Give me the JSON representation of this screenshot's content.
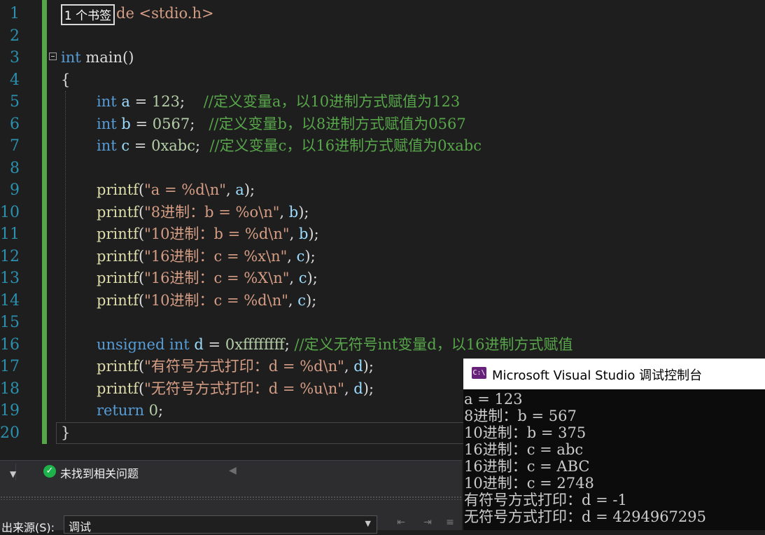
{
  "editor": {
    "bookmark_label": "1 个书签",
    "line_numbers": [
      "1",
      "2",
      "3",
      "4",
      "5",
      "6",
      "7",
      "8",
      "9",
      "10",
      "11",
      "12",
      "13",
      "14",
      "15",
      "16",
      "17",
      "18",
      "19",
      "20"
    ],
    "code": {
      "l1_rest": "de <stdio.h>",
      "l3_kw": "int",
      "l3_fn": " main",
      "l3_rest": "()",
      "l4": "{",
      "l5_kw": "int",
      "l5_var": " a",
      "l5_op": " = ",
      "l5_num": "123",
      "l5_semi": ";",
      "l5_cm": "    //定义变量a，以10进制方式赋值为123",
      "l6_kw": "int",
      "l6_var": " b",
      "l6_op": " = ",
      "l6_num": "0567",
      "l6_semi": ";",
      "l6_cm": "   //定义变量b，以8进制方式赋值为0567",
      "l7_kw": "int",
      "l7_var": " c",
      "l7_op": " = ",
      "l7_num": "0xabc",
      "l7_semi": ";",
      "l7_cm": "  //定义变量c，以16进制方式赋值为0xabc",
      "l9_fn": "printf",
      "l9_p": "(",
      "l9_str": "\"a = %d\\n\"",
      "l9_c": ", ",
      "l9_var": "a",
      "l9_end": ");",
      "l10_fn": "printf",
      "l10_p": "(",
      "l10_str": "\"8进制：b = %o\\n\"",
      "l10_c": ", ",
      "l10_var": "b",
      "l10_end": ");",
      "l11_fn": "printf",
      "l11_p": "(",
      "l11_str": "\"10进制：b = %d\\n\"",
      "l11_c": ", ",
      "l11_var": "b",
      "l11_end": ");",
      "l12_fn": "printf",
      "l12_p": "(",
      "l12_str": "\"16进制：c = %x\\n\"",
      "l12_c": ", ",
      "l12_var": "c",
      "l12_end": ");",
      "l13_fn": "printf",
      "l13_p": "(",
      "l13_str": "\"16进制：c = %X\\n\"",
      "l13_c": ", ",
      "l13_var": "c",
      "l13_end": ");",
      "l14_fn": "printf",
      "l14_p": "(",
      "l14_str": "\"10进制：c = %d\\n\"",
      "l14_c": ", ",
      "l14_var": "c",
      "l14_end": ");",
      "l16_kw": "unsigned int",
      "l16_var": " d",
      "l16_op": " = ",
      "l16_num": "0xffffffff",
      "l16_semi": ";",
      "l16_cm": " //定义无符号int变量d，以16进制方式赋值",
      "l17_fn": "printf",
      "l17_p": "(",
      "l17_str": "\"有符号方式打印：d = %d\\n\"",
      "l17_c": ", ",
      "l17_var": "d",
      "l17_end": ");",
      "l18_fn": "printf",
      "l18_p": "(",
      "l18_str": "\"无符号方式打印：d = %u\\n\"",
      "l18_c": ", ",
      "l18_var": "d",
      "l18_end": ");",
      "l19_kw": "return",
      "l19_num": " 0",
      "l19_semi": ";",
      "l20": "}"
    }
  },
  "status": {
    "issues_text": "未找到相关问题"
  },
  "output": {
    "source_label": "出来源(S):",
    "source_value": "调试"
  },
  "console": {
    "title": "Microsoft Visual Studio 调试控制台",
    "icon_text": "C:\\",
    "lines": [
      "a = 123",
      "8进制：b = 567",
      "10进制：b = 375",
      "16进制：c = abc",
      "16进制：c = ABC",
      "10进制：c = 2748",
      "有符号方式打印：d = -1",
      "无符号方式打印：d = 4294967295"
    ]
  },
  "colors": {
    "keyword": "#569cd6",
    "function": "#dcdcaa",
    "string": "#d69d85",
    "comment": "#57a64a",
    "line_number": "#2b91af",
    "change_bar": "#57a64a"
  }
}
